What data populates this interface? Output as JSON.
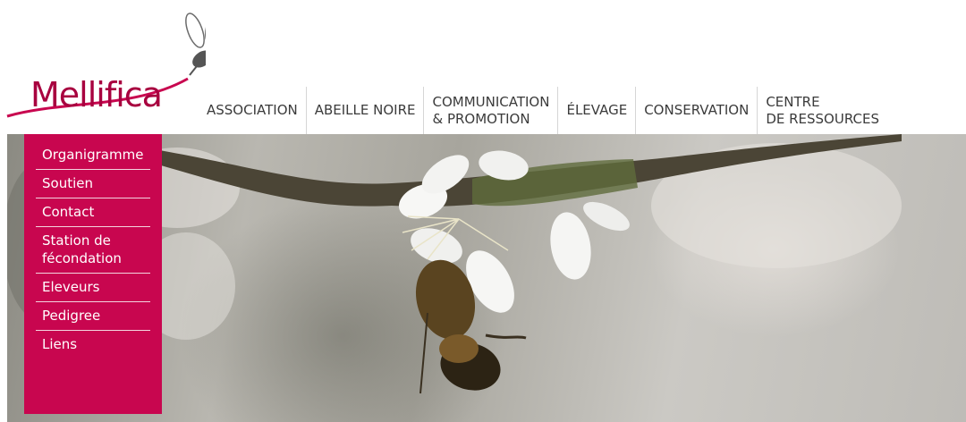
{
  "logo": {
    "text": "Mellifica"
  },
  "nav": {
    "items": [
      {
        "label": "ASSOCIATION"
      },
      {
        "label": "ABEILLE NOIRE"
      },
      {
        "line1": "COMMUNICATION",
        "line2": "& PROMOTION"
      },
      {
        "label": "ÉLEVAGE"
      },
      {
        "label": "CONSERVATION"
      },
      {
        "line1": "CENTRE",
        "line2": "DE RESSOURCES"
      }
    ]
  },
  "submenu": {
    "items": [
      {
        "label": "Organigramme"
      },
      {
        "label": "Soutien"
      },
      {
        "label": "Contact"
      },
      {
        "label": "Station de fécondation"
      },
      {
        "label": "Eleveurs"
      },
      {
        "label": "Pedigree"
      },
      {
        "label": "Liens"
      }
    ]
  },
  "colors": {
    "brand": "#c8064f",
    "nav_text": "#3b3b3b"
  },
  "hero": {
    "icon": "bee-on-flower-photo"
  }
}
